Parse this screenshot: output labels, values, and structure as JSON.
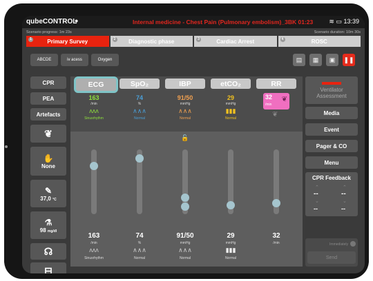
{
  "status": {
    "app_name": "qubeCONTROL",
    "scenario": "Internal medicine - Chest Pain (Pulmonary embolism)_3BK",
    "timer": "01:23",
    "clock": "13:39"
  },
  "progress": {
    "left": "Scenario progress: 1m 23s",
    "right": "Scenario duration: 10m 30s"
  },
  "tabs": [
    "Primary Survey",
    "Diagnostic phase",
    "Cardiac Arrest",
    "ROSC"
  ],
  "tab_numbers": [
    "1",
    "2",
    "3",
    "4"
  ],
  "toolbar": {
    "abcde": "ABCDE",
    "iv": "iv acess",
    "oxygen": "Oxygen"
  },
  "left_buttons": {
    "cpr": "CPR",
    "pea": "PEA",
    "artefacts": "Artefacts",
    "none": "None",
    "temp": "37,0",
    "temp_unit": "°C",
    "glucose": "98",
    "glucose_unit": "mg/dl"
  },
  "vitals": [
    {
      "name": "ECG",
      "value": "163",
      "unit": "/min",
      "wave_label": "Sinusrhythm",
      "bottom_value": "163",
      "bottom_unit": "/min",
      "bottom_wave_label": "Sinusrhythm"
    },
    {
      "name": "SpO₂",
      "value": "74",
      "unit": "%",
      "wave_label": "Normal",
      "bottom_value": "74",
      "bottom_unit": "%",
      "bottom_wave_label": "Normal"
    },
    {
      "name": "IBP",
      "value": "91/50",
      "unit": "mmHg",
      "wave_label": "Normal",
      "bottom_value": "91/50",
      "bottom_unit": "mmHg",
      "bottom_wave_label": "Normal"
    },
    {
      "name": "etCO₂",
      "value": "29",
      "unit": "mmHg",
      "wave_label": "Normal",
      "bottom_value": "29",
      "bottom_unit": "mmHg",
      "bottom_wave_label": "Normal"
    },
    {
      "name": "RR",
      "value": "32",
      "unit": "/min",
      "wave_label": "",
      "bottom_value": "32",
      "bottom_unit": "/min",
      "bottom_wave_label": ""
    }
  ],
  "right_buttons": {
    "ventilator_title": "Ventilator",
    "ventilator_sub": "Assessment",
    "media": "Media",
    "event": "Event",
    "pager": "Pager & CO",
    "menu": "Menu",
    "cpr_feedback": "CPR Feedback",
    "dash": "--",
    "immediately": "Immediately",
    "send": "Send"
  },
  "colors": {
    "ecg": "#8ee03c",
    "spo2": "#4a9fd8",
    "ibp": "#f0a050",
    "etco2": "#f0c020",
    "rr": "#f06fc0",
    "alert": "#e8230f"
  }
}
